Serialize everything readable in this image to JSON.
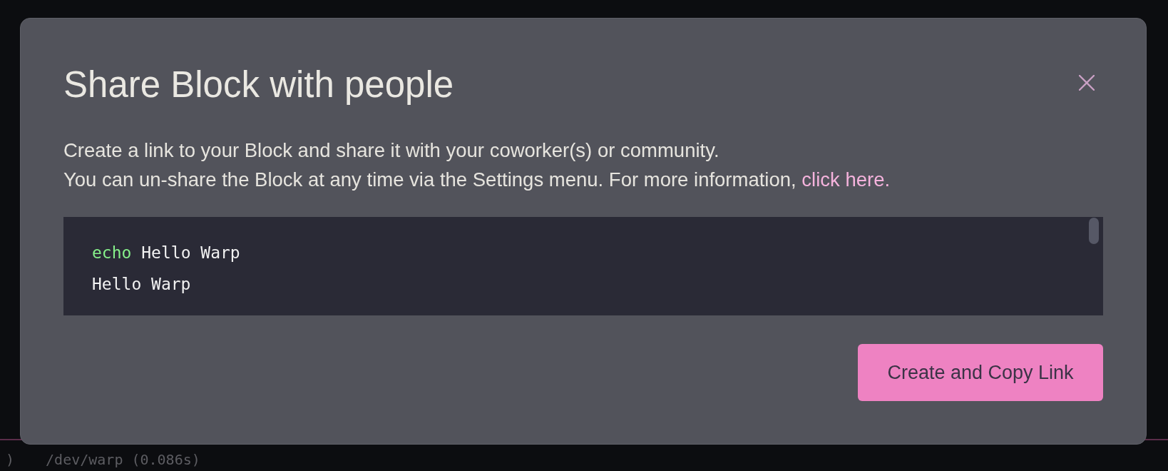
{
  "dialog": {
    "title": "Share Block with people",
    "description": [
      "Create a link to your Block and share it with your coworker(s) or community.",
      "You can un-share the Block at any time via the Settings menu. For more information,"
    ],
    "link": "click here.",
    "code_block": {
      "lines": [
        {
          "kind": "command",
          "command": "echo",
          "args": "Hello Warp"
        },
        {
          "kind": "output",
          "text": "Hello Warp"
        }
      ]
    },
    "button": "Create and Copy Link"
  },
  "terminal": {
    "prompt_fragment": ")",
    "prompt_text": "/dev/warp (0.086s)"
  }
}
